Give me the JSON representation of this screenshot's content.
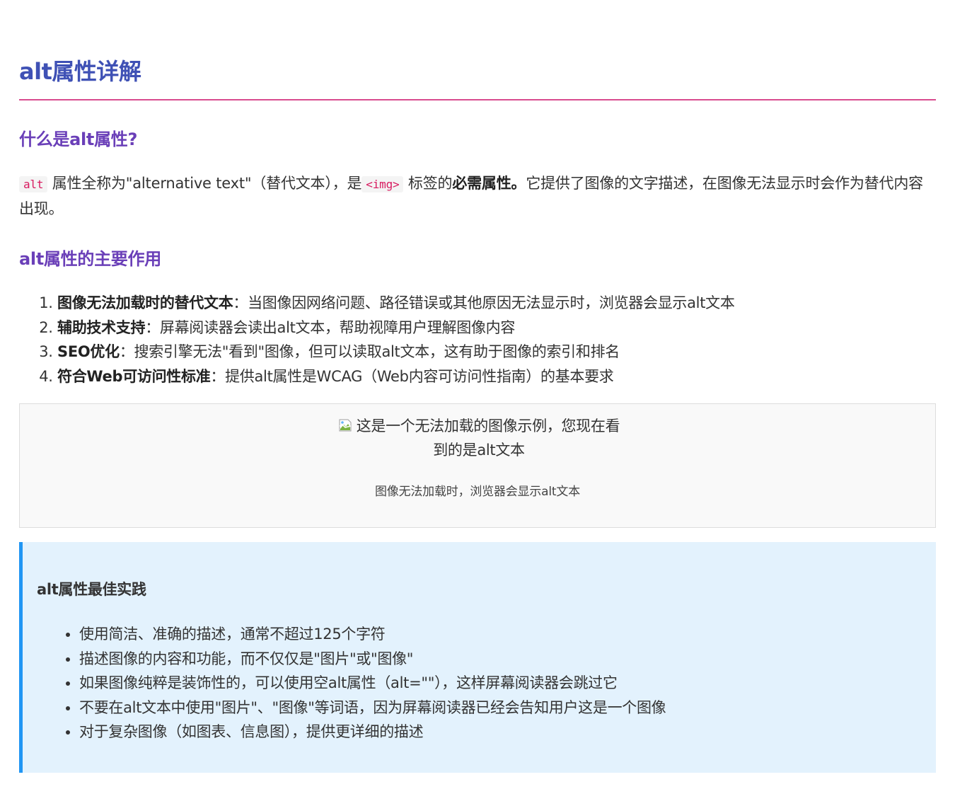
{
  "heading": "alt属性详解",
  "section1": {
    "title": "什么是alt属性?",
    "code_alt": "alt",
    "text_1": "属性全称为\"alternative text\"（替代文本），是",
    "code_img": "<img>",
    "text_2": "标签的",
    "bold": "必需属性。",
    "text_3": "它提供了图像的文字描述，在图像无法显示时会作为替代内容出现。"
  },
  "section2": {
    "title": "alt属性的主要作用",
    "items": [
      {
        "bold": "图像无法加载时的替代文本",
        "text": "：当图像因网络问题、路径错误或其他原因无法显示时，浏览器会显示alt文本"
      },
      {
        "bold": "辅助技术支持",
        "text": "：屏幕阅读器会读出alt文本，帮助视障用户理解图像内容"
      },
      {
        "bold": "SEO优化",
        "text": "：搜索引擎无法\"看到\"图像，但可以读取alt文本，这有助于图像的索引和排名"
      },
      {
        "bold": "符合Web可访问性标准",
        "text": "：提供alt属性是WCAG（Web内容可访问性指南）的基本要求"
      }
    ]
  },
  "figure": {
    "alt_text": "这是一个无法加载的图像示例，您现在看到的是alt文本",
    "caption": "图像无法加载时，浏览器会显示alt文本",
    "icon": "broken-image-icon"
  },
  "tip": {
    "title": "alt属性最佳实践",
    "items": [
      "使用简洁、准确的描述，通常不超过125个字符",
      "描述图像的内容和功能，而不仅仅是\"图片\"或\"图像\"",
      "如果图像纯粹是装饰性的，可以使用空alt属性（alt=\"\"），这样屏幕阅读器会跳过它",
      "不要在alt文本中使用\"图片\"、\"图像\"等词语，因为屏幕阅读器已经会告知用户这是一个图像",
      "对于复杂图像（如图表、信息图），提供更详细的描述"
    ],
    "accent_color": "#2196f3"
  },
  "colors": {
    "heading": "#3f51b5",
    "subheading": "#6a3fb8",
    "rule": "#d94c8f",
    "code": "#d81b60"
  }
}
